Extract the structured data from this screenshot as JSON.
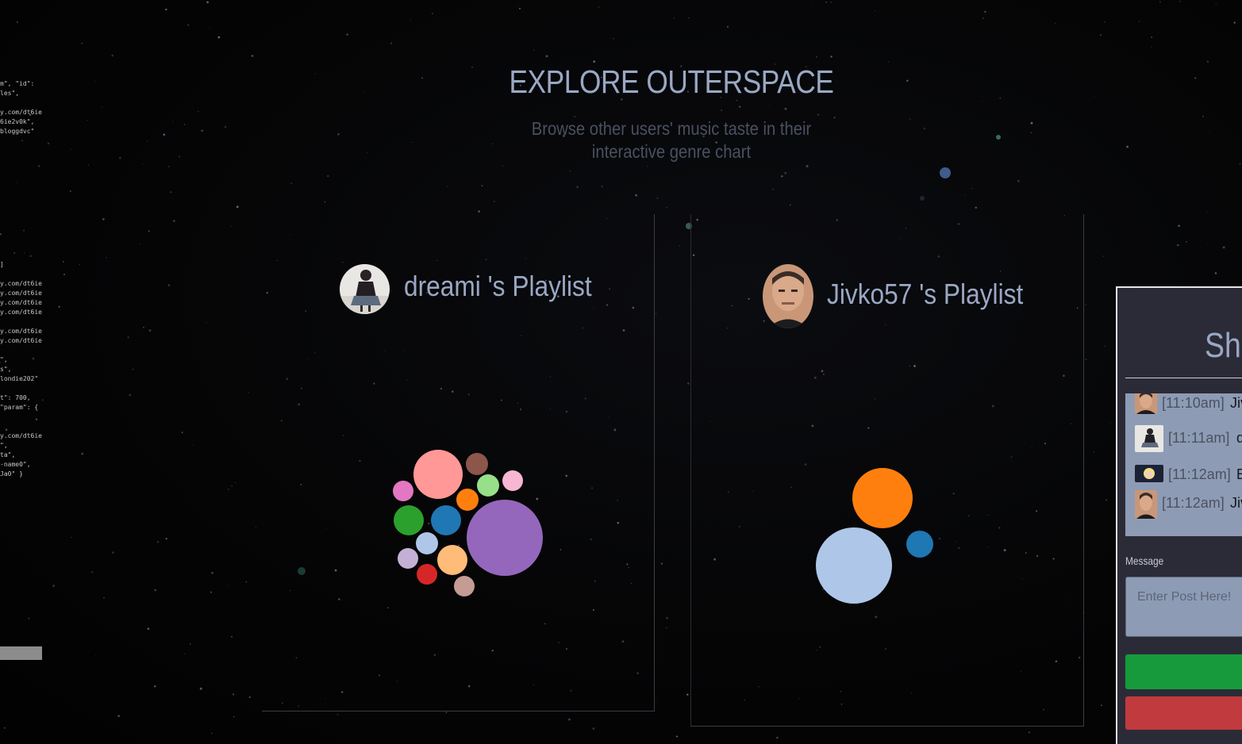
{
  "header": {
    "title": "EXPLORE OUTERSPACE",
    "subtitle_line1": "Browse other users' music taste in their",
    "subtitle_line2": "interactive genre chart"
  },
  "code_snippet": {
    "lines": [
      "m\", \"id\":",
      "les\",",
      "",
      "y.com/dt6ie",
      "6ie2v0k\",",
      "bloggdvc\"",
      "",
      "",
      "",
      "",
      "",
      "",
      "",
      "",
      "",
      "",
      "",
      "",
      "",
      "]",
      "",
      "y.com/dt6ie",
      "y.com/dt6ie",
      "y.com/dt6ie",
      "y.com/dt6ie",
      "",
      "y.com/dt6ie",
      "y.com/dt6ie",
      "",
      "\",",
      "s\",",
      "londie202\"",
      "",
      "t\": 700,",
      "\"param\": {",
      "",
      "",
      "y.com/dt6ie",
      "\",",
      "ta\",",
      "-name0\",",
      "Ja0\" }"
    ]
  },
  "playlists": [
    {
      "user": "dreami",
      "title": "dreami 's Playlist",
      "avatar_icon": "user-avatar-dreami",
      "genre_bubbles": [
        {
          "color": "#9467bd",
          "weight": 48
        },
        {
          "color": "#ff9896",
          "weight": 31
        },
        {
          "color": "#2ca02c",
          "weight": 19
        },
        {
          "color": "#1f77b4",
          "weight": 19
        },
        {
          "color": "#ffbb78",
          "weight": 19
        },
        {
          "color": "#aec7e8",
          "weight": 14
        },
        {
          "color": "#8c564b",
          "weight": 14
        },
        {
          "color": "#ff7f0e",
          "weight": 14
        },
        {
          "color": "#98df8a",
          "weight": 14
        },
        {
          "color": "#f7b6d2",
          "weight": 13
        },
        {
          "color": "#e377c2",
          "weight": 13
        },
        {
          "color": "#c5b0d5",
          "weight": 13
        },
        {
          "color": "#d62728",
          "weight": 13
        },
        {
          "color": "#c49c94",
          "weight": 13
        }
      ]
    },
    {
      "user": "Jivko57",
      "title": "Jivko57 's Playlist",
      "avatar_icon": "user-avatar-jivko57",
      "genre_bubbles": [
        {
          "color": "#aec7e8",
          "weight": 48
        },
        {
          "color": "#ff7f0e",
          "weight": 38
        },
        {
          "color": "#1f77b4",
          "weight": 17
        }
      ]
    }
  ],
  "shoutbox": {
    "title": "Sho",
    "messages": [
      {
        "time": "[11:10am]",
        "user": "Jiv",
        "avatar_icon": "user-avatar-jivko57"
      },
      {
        "time": "[11:11am]",
        "user": "d",
        "avatar_icon": "user-avatar-dreami"
      },
      {
        "time": "[11:12am]",
        "user": "B",
        "avatar_icon": "user-avatar-anime"
      },
      {
        "time": "[11:12am]",
        "user": "Jiv",
        "avatar_icon": "user-avatar-jivko57"
      }
    ],
    "message_label": "Message",
    "input_placeholder": "Enter Post Here!",
    "post_button_color": "#169a3c",
    "clear_button_color": "#c03a3e"
  },
  "colors": {
    "title": "#9aa8c4",
    "subtitle": "#4a5060",
    "background": "#030304"
  }
}
